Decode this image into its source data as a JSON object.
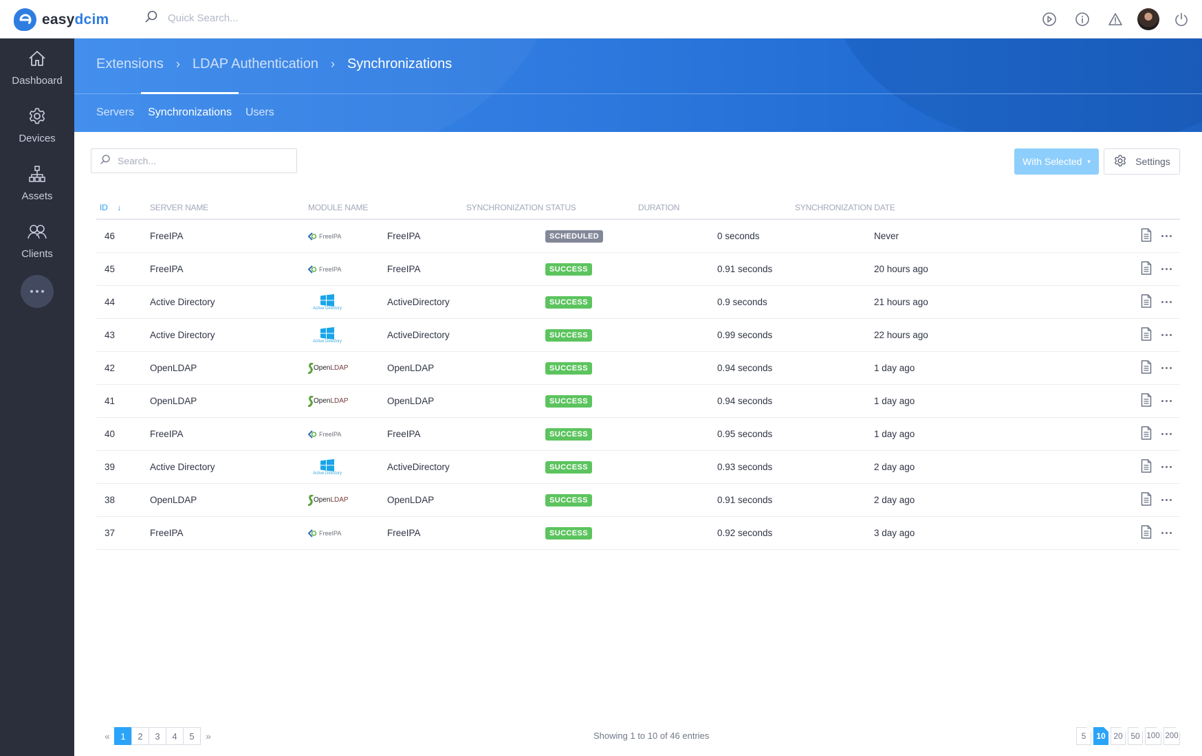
{
  "app": {
    "brand_prefix": "easy",
    "brand_suffix": "dcim",
    "brand_color": "#2f7de1",
    "quick_search_placeholder": "Quick Search..."
  },
  "topbar_icons": [
    "play-circle-icon",
    "info-icon",
    "warning-icon",
    "user-avatar",
    "power-icon"
  ],
  "sidebar": {
    "items": [
      {
        "label": "Dashboard",
        "icon": "home-icon"
      },
      {
        "label": "Devices",
        "icon": "gear-icon"
      },
      {
        "label": "Assets",
        "icon": "sitemap-icon"
      },
      {
        "label": "Clients",
        "icon": "users-icon"
      }
    ],
    "more_icon": "more-horizontal-icon"
  },
  "breadcrumb": [
    {
      "label": "Extensions"
    },
    {
      "label": "LDAP Authentication"
    },
    {
      "label": "Synchronizations"
    }
  ],
  "tabs": [
    {
      "label": "Servers",
      "active": false
    },
    {
      "label": "Synchronizations",
      "active": true
    },
    {
      "label": "Users",
      "active": false
    }
  ],
  "toolbar": {
    "search_placeholder": "Search...",
    "with_selected_label": "With Selected",
    "settings_label": "Settings"
  },
  "table": {
    "columns": {
      "id": "ID",
      "server": "Server Name",
      "module": "Module Name",
      "status": "Synchronization Status",
      "duration": "Duration",
      "date": "Synchronization Date"
    },
    "sort": {
      "column": "id",
      "direction": "desc"
    },
    "rows": [
      {
        "id": "46",
        "server": "FreeIPA",
        "logo": "freeipa",
        "module": "FreeIPA",
        "status": "SCHEDULED",
        "duration": "0 seconds",
        "date": "Never"
      },
      {
        "id": "45",
        "server": "FreeIPA",
        "logo": "freeipa",
        "module": "FreeIPA",
        "status": "SUCCESS",
        "duration": "0.91 seconds",
        "date": "20 hours ago"
      },
      {
        "id": "44",
        "server": "Active Directory",
        "logo": "activedirectory",
        "module": "ActiveDirectory",
        "status": "SUCCESS",
        "duration": "0.9 seconds",
        "date": "21 hours ago"
      },
      {
        "id": "43",
        "server": "Active Directory",
        "logo": "activedirectory",
        "module": "ActiveDirectory",
        "status": "SUCCESS",
        "duration": "0.99 seconds",
        "date": "22 hours ago"
      },
      {
        "id": "42",
        "server": "OpenLDAP",
        "logo": "openldap",
        "module": "OpenLDAP",
        "status": "SUCCESS",
        "duration": "0.94 seconds",
        "date": "1 day ago"
      },
      {
        "id": "41",
        "server": "OpenLDAP",
        "logo": "openldap",
        "module": "OpenLDAP",
        "status": "SUCCESS",
        "duration": "0.94 seconds",
        "date": "1 day ago"
      },
      {
        "id": "40",
        "server": "FreeIPA",
        "logo": "freeipa",
        "module": "FreeIPA",
        "status": "SUCCESS",
        "duration": "0.95 seconds",
        "date": "1 day ago"
      },
      {
        "id": "39",
        "server": "Active Directory",
        "logo": "activedirectory",
        "module": "ActiveDirectory",
        "status": "SUCCESS",
        "duration": "0.93 seconds",
        "date": "2 day ago"
      },
      {
        "id": "38",
        "server": "OpenLDAP",
        "logo": "openldap",
        "module": "OpenLDAP",
        "status": "SUCCESS",
        "duration": "0.91 seconds",
        "date": "2 day ago"
      },
      {
        "id": "37",
        "server": "FreeIPA",
        "logo": "freeipa",
        "module": "FreeIPA",
        "status": "SUCCESS",
        "duration": "0.92 seconds",
        "date": "3 day ago"
      }
    ],
    "logo_text": {
      "freeipa": "FreeIPA",
      "activedirectory": "Active Directory",
      "openldap_a": "Open",
      "openldap_b": "LDAP"
    }
  },
  "status_colors": {
    "SUCCESS": "#5cc45e",
    "SCHEDULED": "#828898"
  },
  "pagination": {
    "pages": [
      "1",
      "2",
      "3",
      "4",
      "5"
    ],
    "current_page": "1",
    "prev_icon": "double-chevron-left-icon",
    "next_icon": "double-chevron-right-icon",
    "summary": "Showing 1 to 10 of 46 entries",
    "page_sizes": [
      "5",
      "10",
      "20",
      "50",
      "100",
      "200"
    ],
    "current_page_size": "10"
  }
}
